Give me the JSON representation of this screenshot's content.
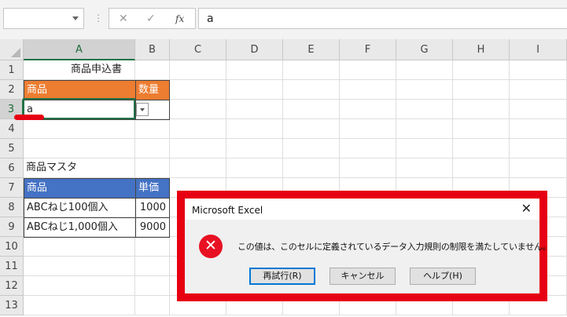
{
  "formula_bar": {
    "name_box": "",
    "cancel_icon": "✕",
    "enter_icon": "✓",
    "fx_label": "fx",
    "separator": "⋮",
    "content": "a"
  },
  "columns": [
    "A",
    "B",
    "C",
    "D",
    "E",
    "F",
    "G",
    "H",
    "I"
  ],
  "rows": [
    "1",
    "2",
    "3",
    "4",
    "5",
    "6",
    "7",
    "8",
    "9",
    "10",
    "11",
    "12",
    "13"
  ],
  "cells": {
    "a1": "商品申込書",
    "a2": "商品",
    "b2": "数量",
    "a3": "a",
    "a6": "商品マスタ",
    "a7": "商品",
    "b7": "単価",
    "a8": "ABCねじ100個入",
    "b8": "1000",
    "a9": "ABCねじ1,000個入",
    "b9": "9000"
  },
  "colors": {
    "header_orange": "#ed7d31",
    "header_blue": "#4472c4",
    "highlight_red": "#e60012",
    "excel_green": "#217346"
  },
  "dialog": {
    "title": "Microsoft Excel",
    "close_icon": "✕",
    "error_icon": "✕",
    "message": "この値は、このセルに定義されているデータ入力規則の制限を満たしていません。",
    "retry_label": "再試行(R)",
    "cancel_label": "キャンセル",
    "help_label": "ヘルプ(H)"
  }
}
